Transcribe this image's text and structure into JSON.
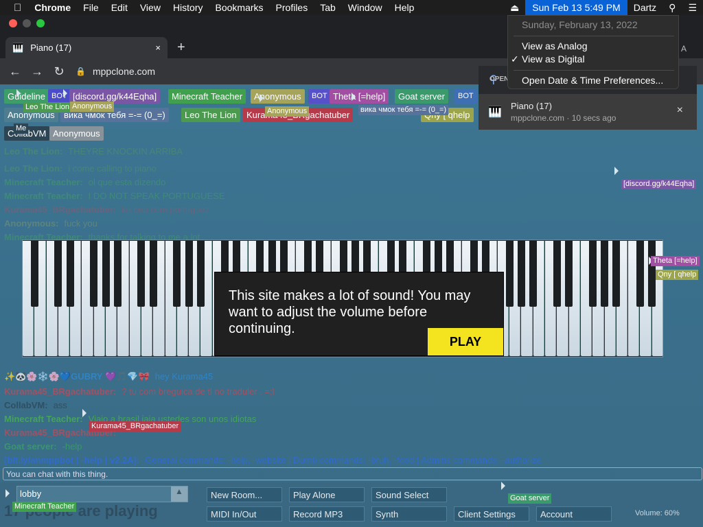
{
  "menubar": {
    "app": "Chrome",
    "items": [
      "File",
      "Edit",
      "View",
      "History",
      "Bookmarks",
      "Profiles",
      "Tab",
      "Window",
      "Help"
    ],
    "clock": "Sun Feb 13  5:49 PM",
    "user": "Dartz",
    "icons": [
      "apple-icon",
      "eject-icon",
      "search-icon",
      "control-center-icon"
    ]
  },
  "clock_menu": {
    "date": "Sunday, February 13, 2022",
    "items": [
      "View as Analog",
      "View as Digital",
      "Open Date & Time Preferences..."
    ],
    "checkmark": "✓"
  },
  "browser": {
    "tab_title": "Piano (17)",
    "tab_close": "×",
    "new_tab": "+",
    "url": "mppclone.com",
    "notif_header": "OPEN",
    "notif_title": "Piano (17)",
    "notif_sub": "mppclone.com · 10 secs ago",
    "extra_letter": "A"
  },
  "users": [
    {
      "name": "Guideline",
      "color": "#3e9e6a"
    },
    {
      "name": "BOT",
      "color": "#4b4cc7"
    },
    {
      "name": "[discord.gg/k44Eqha]",
      "color": "#7b55a6"
    },
    {
      "name": "Minecraft Teacher",
      "color": "#41a04e"
    },
    {
      "name": "Anonymous",
      "color": "#a6a35a"
    },
    {
      "name": "BOT",
      "color": "#5751c9"
    },
    {
      "name": "Theta [=help]",
      "color": "#a24ea3"
    },
    {
      "name": "Goat server",
      "color": "#3a9a6c"
    },
    {
      "name": "BOT",
      "color": "#3e6fb5"
    },
    {
      "name": "Anonymous",
      "color": "#4e7d8f"
    },
    {
      "name": "вика чмок тебя =-= (0_=)",
      "color": "#57739b"
    },
    {
      "name": "Leo The Lion",
      "color": "#4c9a4f"
    },
    {
      "name": "Kurama45_BRgachatuber",
      "color": "#b53a4a"
    },
    {
      "name": "CollabVM",
      "color": "#2c4555"
    },
    {
      "name": "Anonymous",
      "color": "#88929a"
    },
    {
      "name": "Qny [ qhelp",
      "color": "#9ca54c"
    }
  ],
  "chat": [
    {
      "name": "Leo The Lion:",
      "text": "THEYRE KNOCKIN ARRIBA",
      "color": "#5fa84d"
    },
    {
      "name": "Leo The Lion:",
      "text": "i come calling to piano",
      "color": "#5fa84d"
    },
    {
      "name": "Minecraft Teacher:",
      "text": "ol que esta dizendo",
      "color": "#46b74b"
    },
    {
      "name": "Minecraft Teacher:",
      "text": "I DO NOT SPEAK PORTUGUESE",
      "color": "#46b74b"
    },
    {
      "name": "Kurama45_BRgachatuber:",
      "text": "ko ceu com portuguez",
      "color": "#c34a58"
    },
    {
      "name": "Anonymous:",
      "text": "fuck you",
      "color": "#9ea85a"
    },
    {
      "name": "Minecraft Teacher:",
      "text": "thanks for talking to me a lot",
      "color": "#46b74b"
    },
    {
      "name": "✨🐼🌸❄️🌸💙GUBRY 💜🎵💎🎀",
      "text": "hey Kurama45",
      "color": "#2f8bd5"
    },
    {
      "name": "Kurama45_BRgachatuber:",
      "text": "? tu com breguica de tl no traduler . =;l",
      "color": "#c34a58"
    },
    {
      "name": "CollabVM:",
      "text": "ass",
      "color": "#2c4555"
    },
    {
      "name": "Minecraft Teacher:",
      "text": "Viajo a brasil jaja ustedes son unos idiotas",
      "color": "#46b74b"
    },
    {
      "name": "Kurama45_BRgachatuber:",
      "text": "",
      "color": "#c34a58"
    },
    {
      "name": "Goat server:",
      "text": "-help",
      "color": "#3a9a6c"
    },
    {
      "name": "[bit.ly/anmppbot | -help | v2.2A]:",
      "text": "General commands: -help, -website | Dumb commands: -bruh, -food | Admins commands: -authorize",
      "color": "#2f6bd5"
    }
  ],
  "modal": {
    "message": "This site makes a lot of sound! You may want to adjust the volume before continuing.",
    "button": "PLAY"
  },
  "chat_input_placeholder": "You can chat with this thing.",
  "room": {
    "value": "lobby",
    "arrow": "▲"
  },
  "buttons": [
    "New Room...",
    "Play Alone",
    "Sound Select",
    "MIDI In/Out",
    "Record MP3",
    "Synth",
    "Client Settings",
    "Account"
  ],
  "players": "17 people are playing",
  "volume": "Volume: 60%",
  "cursor_tags": [
    {
      "name": "Leo The Lion",
      "color": "#4c9a4f"
    },
    {
      "name": "Anonymous",
      "color": "#a6a35a"
    },
    {
      "name": "Anonymous",
      "color": "#a6a35a"
    },
    {
      "name": "вика чмок тебя =-= (0_=)",
      "color": "#57739b"
    },
    {
      "name": "Me",
      "color": "#2c4555"
    },
    {
      "name": "[discord.gg/k44Eqha]",
      "color": "#7b55a6"
    },
    {
      "name": "Theta [=help]",
      "color": "#a24ea3"
    },
    {
      "name": "Qny [ qhelp",
      "color": "#9ca54c"
    },
    {
      "name": "Kurama45_BRgachatuber",
      "color": "#b53a4a"
    },
    {
      "name": "Goat server",
      "color": "#3a9a6c"
    },
    {
      "name": "Minecraft Teacher",
      "color": "#41a04e"
    }
  ]
}
